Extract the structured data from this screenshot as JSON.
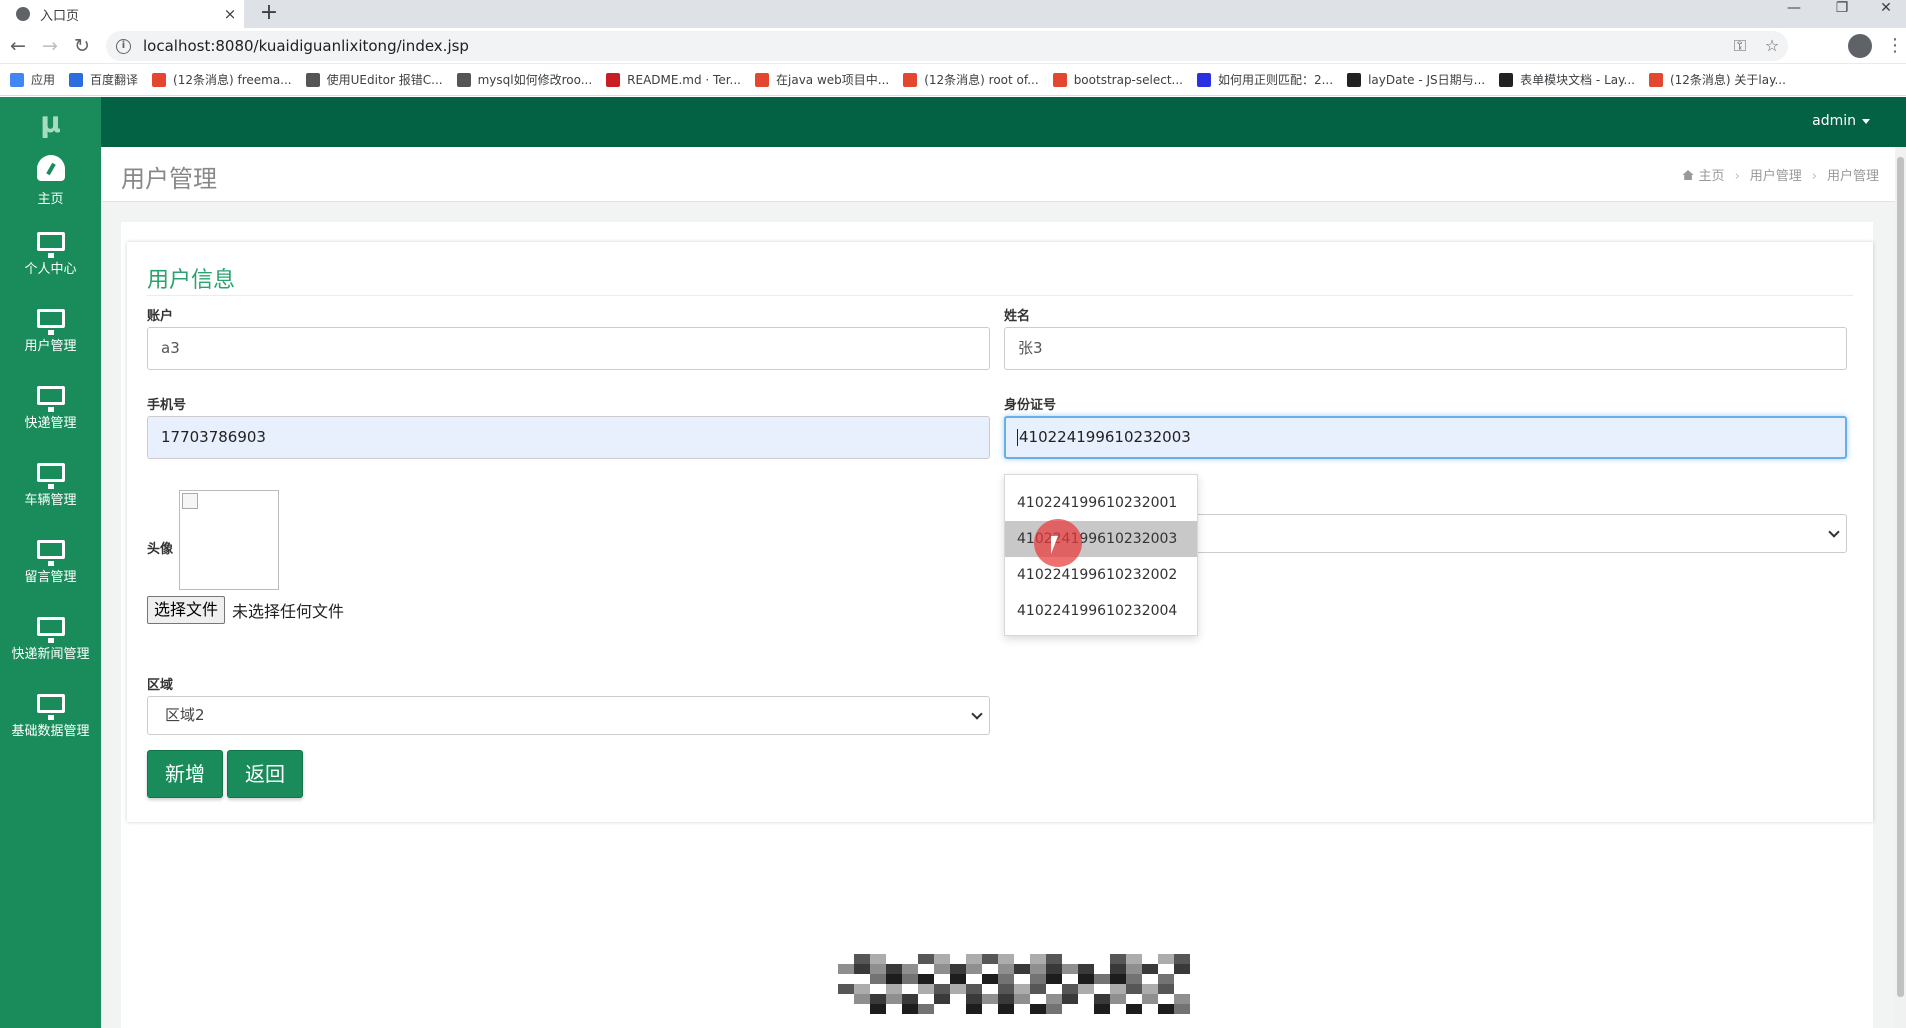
{
  "browser": {
    "tab_title": "入口页",
    "tab_close": "×",
    "new_tab": "+",
    "url": "localhost:8080/kuaidiguanlixitong/index.jsp",
    "bookmarks": [
      {
        "label": "应用",
        "color": "#4285f4"
      },
      {
        "label": "百度翻译",
        "color": "#2d6cdf"
      },
      {
        "label": "(12条消息) freema...",
        "color": "#e4472f"
      },
      {
        "label": "使用UEditor 报错C...",
        "color": "#555555"
      },
      {
        "label": "mysql如何修改roo...",
        "color": "#555555"
      },
      {
        "label": "README.md · Ter...",
        "color": "#c71d23"
      },
      {
        "label": "在java web项目中...",
        "color": "#e4472f"
      },
      {
        "label": "(12条消息) root of...",
        "color": "#e4472f"
      },
      {
        "label": "bootstrap-select...",
        "color": "#e4472f"
      },
      {
        "label": "如何用正则匹配：2...",
        "color": "#2932e1"
      },
      {
        "label": "layDate - JS日期与...",
        "color": "#222222"
      },
      {
        "label": "表单模块文档 - Lay...",
        "color": "#222222"
      },
      {
        "label": "(12条消息) 关于lay...",
        "color": "#e4472f"
      }
    ]
  },
  "app": {
    "brand": "μ",
    "user": "admin",
    "sidebar": [
      {
        "label": "主页",
        "icon": "dashboard-icon"
      },
      {
        "label": "个人中心",
        "icon": "monitor-icon"
      },
      {
        "label": "用户管理",
        "icon": "monitor-icon"
      },
      {
        "label": "快递管理",
        "icon": "monitor-icon"
      },
      {
        "label": "车辆管理",
        "icon": "monitor-icon"
      },
      {
        "label": "留言管理",
        "icon": "monitor-icon"
      },
      {
        "label": "快递新闻管理",
        "icon": "monitor-icon"
      },
      {
        "label": "基础数据管理",
        "icon": "monitor-icon"
      }
    ],
    "page_title": "用户管理",
    "breadcrumb": [
      "主页",
      "用户管理",
      "用户管理"
    ],
    "form": {
      "title": "用户信息",
      "account_label": "账户",
      "account_value": "a3",
      "name_label": "姓名",
      "name_value": "张3",
      "phone_label": "手机号",
      "phone_value": "17703786903",
      "idcard_label": "身份证号",
      "idcard_value": "410224199610232003",
      "avatar_label": "头像",
      "file_button": "选择文件",
      "file_status": "未选择任何文件",
      "region_label": "区域",
      "region_value": "区域2",
      "add_button": "新增",
      "back_button": "返回"
    },
    "autocomplete": [
      "410224199610232001",
      "410224199610232003",
      "410224199610232002",
      "410224199610232004"
    ],
    "colors": {
      "sidebar": "#1a8c5b",
      "topnav": "#046244",
      "accent": "#2ba36e"
    }
  }
}
